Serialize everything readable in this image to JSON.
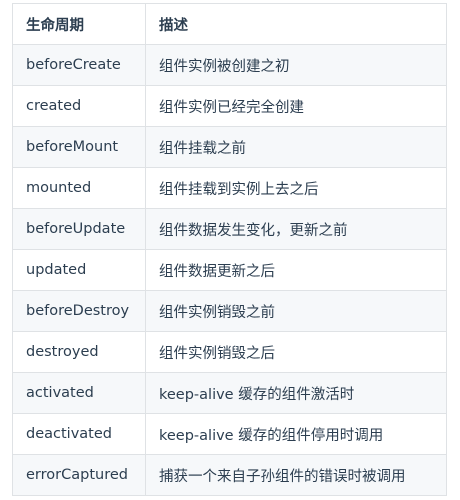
{
  "table": {
    "headers": [
      "生命周期",
      "描述"
    ],
    "rows": [
      [
        "beforeCreate",
        "组件实例被创建之初"
      ],
      [
        "created",
        "组件实例已经完全创建"
      ],
      [
        "beforeMount",
        "组件挂载之前"
      ],
      [
        "mounted",
        "组件挂载到实例上去之后"
      ],
      [
        "beforeUpdate",
        "组件数据发生变化，更新之前"
      ],
      [
        "updated",
        "组件数据更新之后"
      ],
      [
        "beforeDestroy",
        "组件实例销毁之前"
      ],
      [
        "destroyed",
        "组件实例销毁之后"
      ],
      [
        "activated",
        "keep-alive 缓存的组件激活时"
      ],
      [
        "deactivated",
        "keep-alive 缓存的组件停用时调用"
      ],
      [
        "errorCaptured",
        "捕获一个来自子孙组件的错误时被调用"
      ]
    ]
  }
}
